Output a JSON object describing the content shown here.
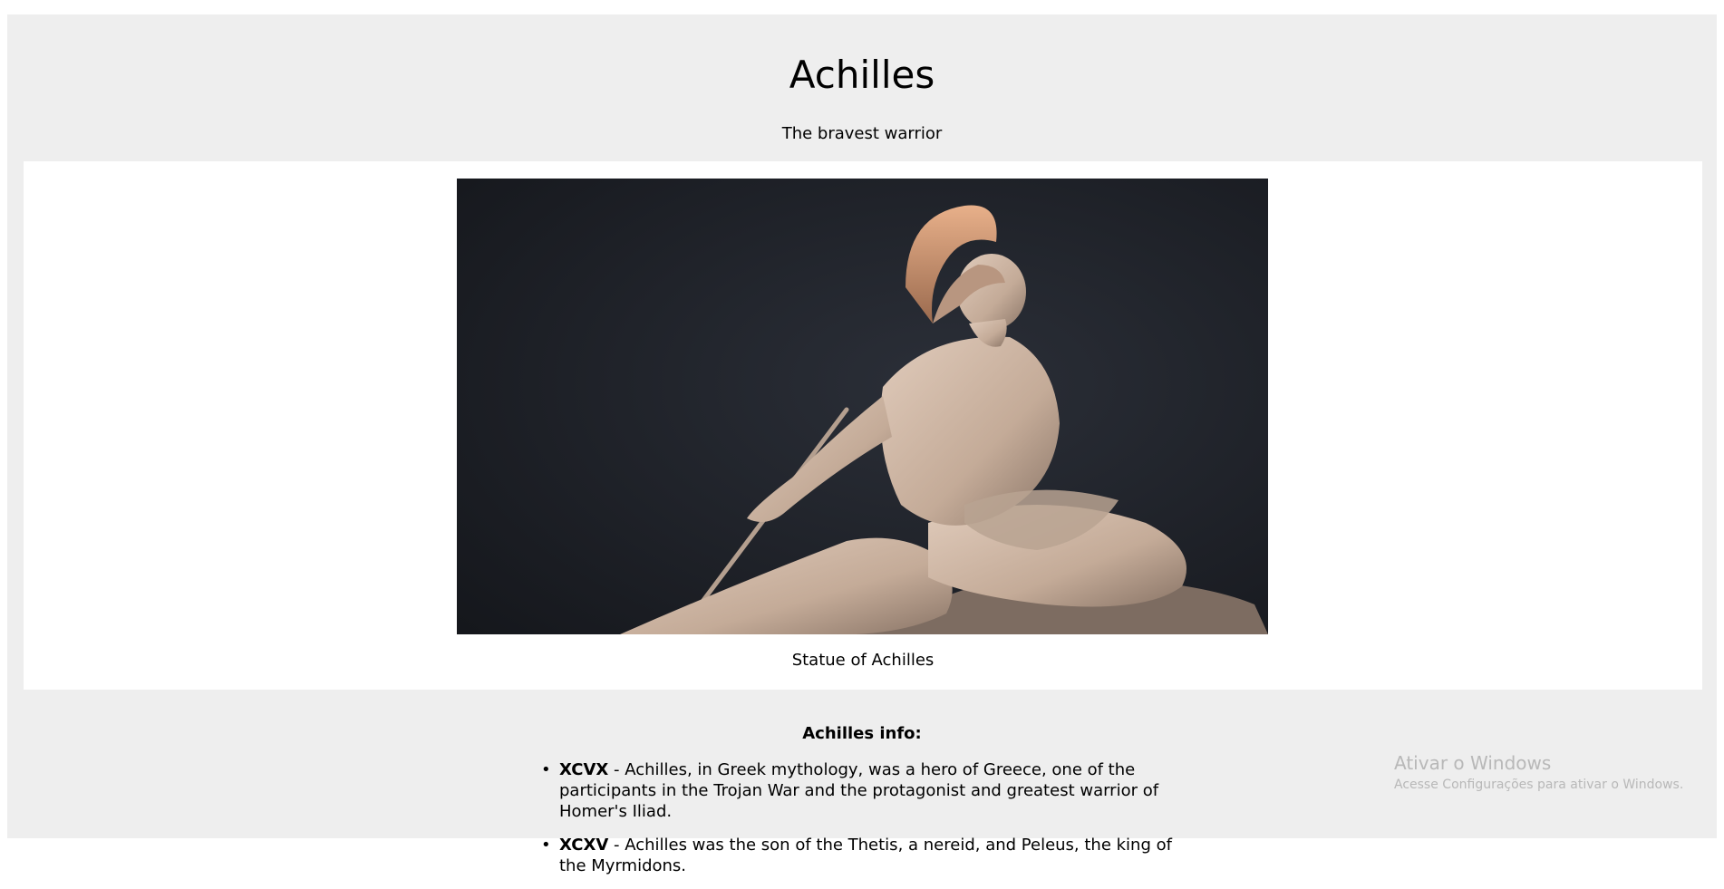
{
  "page": {
    "title": "Achilles",
    "subtitle": "The bravest warrior"
  },
  "figure": {
    "image_alt": "Statue of Achilles",
    "caption": "Statue of Achilles"
  },
  "info": {
    "heading": "Achilles info:",
    "items": [
      {
        "term": "XCVX",
        "text": " - Achilles, in Greek mythology, was a hero of Greece, one of the participants in the Trojan War and the protagonist and greatest warrior of Homer's Iliad."
      },
      {
        "term": "XCXV",
        "text": " - Achilles was the son of the Thetis, a nereid, and Peleus, the king of the Myrmidons."
      }
    ]
  },
  "watermark": {
    "title": "Ativar o Windows",
    "subtitle": "Acesse Configurações para ativar o Windows."
  },
  "colors": {
    "page_bg": "#eeeeee",
    "figure_bg": "#ffffff",
    "image_bg": "#1c1f26",
    "statue": "#c9b3a2",
    "watermark": "#b8b8b8"
  }
}
